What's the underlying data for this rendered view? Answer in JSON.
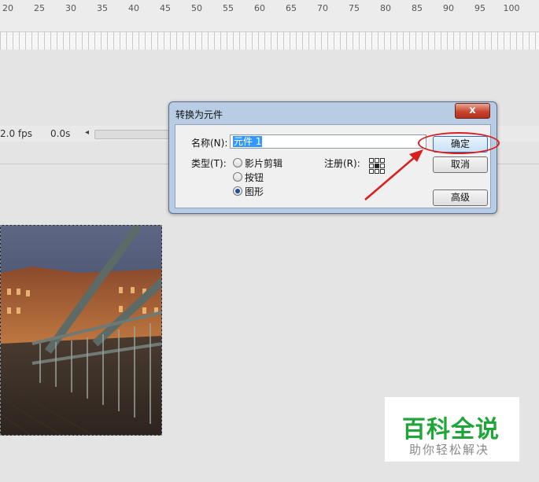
{
  "timeline": {
    "ruler_ticks": [
      "20",
      "25",
      "30",
      "35",
      "40",
      "45",
      "50",
      "55",
      "60",
      "65",
      "70",
      "75",
      "80",
      "85",
      "90",
      "95",
      "100"
    ],
    "fps": "2.0 fps",
    "time": "0.0s",
    "scroll_left_glyph": "◂"
  },
  "dialog": {
    "title": "转换为元件",
    "close_glyph": "x",
    "name_label": "名称(N):",
    "name_value": "元件 1",
    "type_label": "类型(T):",
    "types": [
      {
        "label": "影片剪辑",
        "checked": false
      },
      {
        "label": "按钮",
        "checked": false
      },
      {
        "label": "图形",
        "checked": true
      }
    ],
    "registration_label": "注册(R):",
    "ok_label": "确定",
    "cancel_label": "取消",
    "advanced_label": "高级"
  },
  "annotation_color": "#d81e1e",
  "watermark": {
    "main": "百科全说",
    "sub": "助你轻松解决",
    "main_color": "#1fa638"
  }
}
